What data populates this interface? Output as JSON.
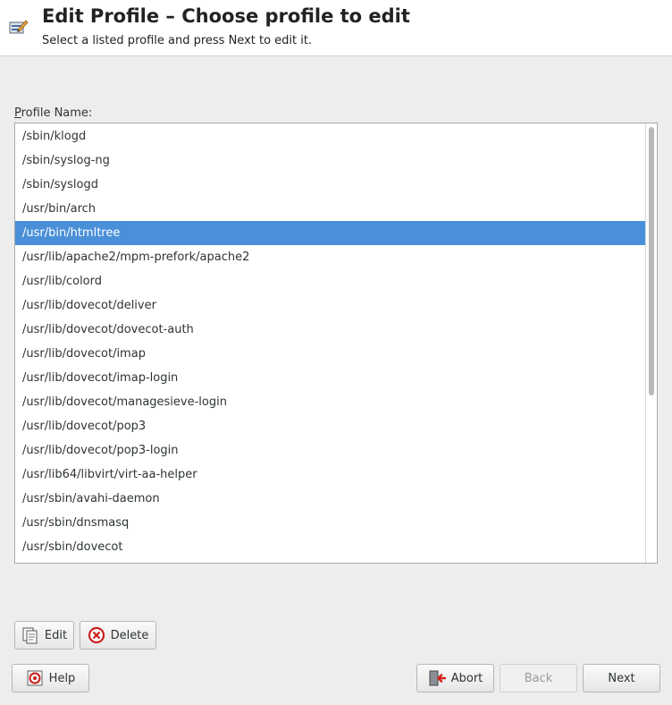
{
  "header": {
    "title": "Edit Profile – Choose profile to edit",
    "subtitle": "Select a listed profile and press Next to edit it.",
    "icon": "edit-profile-icon"
  },
  "list": {
    "label_mnemonic": "P",
    "label_rest": "rofile Name:",
    "selected_index": 4,
    "items": [
      "/sbin/klogd",
      "/sbin/syslog-ng",
      "/sbin/syslogd",
      "/usr/bin/arch",
      "/usr/bin/htmltree",
      "/usr/lib/apache2/mpm-prefork/apache2",
      "/usr/lib/colord",
      "/usr/lib/dovecot/deliver",
      "/usr/lib/dovecot/dovecot-auth",
      "/usr/lib/dovecot/imap",
      "/usr/lib/dovecot/imap-login",
      "/usr/lib/dovecot/managesieve-login",
      "/usr/lib/dovecot/pop3",
      "/usr/lib/dovecot/pop3-login",
      "/usr/lib64/libvirt/virt-aa-helper",
      "/usr/sbin/avahi-daemon",
      "/usr/sbin/dnsmasq",
      "/usr/sbin/dovecot"
    ]
  },
  "actions": {
    "edit_label": "Edit",
    "delete_label": "Delete"
  },
  "footer": {
    "help_label": "Help",
    "abort_label": "Abort",
    "back_label": "Back",
    "next_label": "Next"
  },
  "colors": {
    "selection": "#4a90d9",
    "window_bg": "#ededed",
    "header_bg": "#ffffff"
  }
}
